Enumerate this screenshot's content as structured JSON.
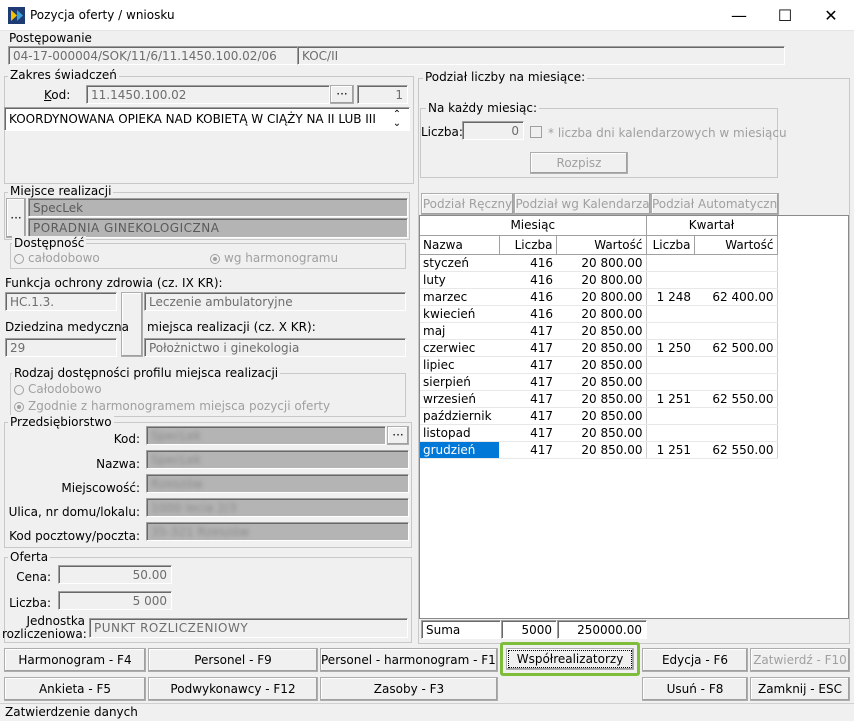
{
  "window": {
    "title": "Pozycja oferty / wniosku",
    "min": "—",
    "max": "☐",
    "close": "✕"
  },
  "postepowanie": {
    "label": "Postępowanie",
    "code": "04-17-000004/SOK/11/6/11.1450.100.02/06",
    "type": "KOC/II"
  },
  "zakres": {
    "label": "Zakres świadczeń",
    "kod_label": "Kod:",
    "kod": "11.1450.100.02",
    "dots": "···",
    "num": "1",
    "desc": "KOORDYNOWANA OPIEKA NAD KOBIETĄ W CIĄŻY NA II LUB III"
  },
  "miejsce": {
    "label": "Miejsce realizacji",
    "dots": "···",
    "name1": "SpecLek",
    "name2": "PORADNIA GINEKOLOGICZNA"
  },
  "dostepnosc": {
    "label": "Dostępność",
    "opt1": "całodobowo",
    "opt2": "wg harmonogramu"
  },
  "funkcja": {
    "label": "Funkcja ochrony zdrowia (cz. IX KR):",
    "code": "HC.1.3.",
    "value": "Leczenie ambulatoryjne"
  },
  "dziedzina": {
    "label": "Dziedzina medyczna",
    "label2": "miejsca realizacji (cz. X KR):",
    "code": "29",
    "value": "Położnictwo i ginekologia"
  },
  "rodzaj": {
    "label": "Rodzaj dostępności profilu miejsca realizacji",
    "opt1": "Całodobowo",
    "opt2": "Zgodnie z harmonogramem miejsca pozycji oferty"
  },
  "przedsiebiorstwo": {
    "label": "Przedsiębiorstwo",
    "kod_label": "Kod:",
    "nazwa_label": "Nazwa:",
    "miejsc_label": "Miejscowość:",
    "ulica_label": "Ulica, nr domu/lokalu:",
    "kodpoczt_label": "Kod pocztowy/poczta:",
    "kod": "SpecLek",
    "nazwa": "SpecLek",
    "miejsc": "Rzeszów",
    "ulica": "1000 lecia 2/3",
    "kodpoczt": "35-321 Rzeszów",
    "dots": "···"
  },
  "oferta": {
    "label": "Oferta",
    "cena_label": "Cena:",
    "cena": "50.00",
    "liczba_label": "Liczba:",
    "liczba": "5 000",
    "jedn_label1": "Jednostka",
    "jedn_label2": "rozliczeniowa:",
    "jedn": "PUNKT ROZLICZENIOWY"
  },
  "podzial": {
    "label": "Podział liczby na miesiące:",
    "kazdy_label": "Na każdy miesiąc:",
    "liczba_label": "Liczba:",
    "liczba": "0",
    "chk_label": "* liczba dni kalendarzowych w miesiącu",
    "rozpisz": "Rozpisz",
    "tab1": "Podział Ręczny",
    "tab2": "Podział wg Kalendarza",
    "tab3": "Podział Automatyczny"
  },
  "grid": {
    "h_miesiac": "Miesiąc",
    "h_kwartal": "Kwartał",
    "h_nazwa": "Nazwa",
    "h_liczba": "Liczba",
    "h_wartosc": "Wartość",
    "h_kliczba": "Liczba",
    "h_kwartosc": "Wartość",
    "rows": [
      {
        "n": "styczeń",
        "l": "416",
        "w": "20 800.00",
        "kl": "",
        "kw": ""
      },
      {
        "n": "luty",
        "l": "416",
        "w": "20 800.00",
        "kl": "",
        "kw": ""
      },
      {
        "n": "marzec",
        "l": "416",
        "w": "20 800.00",
        "kl": "1 248",
        "kw": "62 400.00"
      },
      {
        "n": "kwiecień",
        "l": "416",
        "w": "20 800.00",
        "kl": "",
        "kw": ""
      },
      {
        "n": "maj",
        "l": "417",
        "w": "20 850.00",
        "kl": "",
        "kw": ""
      },
      {
        "n": "czerwiec",
        "l": "417",
        "w": "20 850.00",
        "kl": "1 250",
        "kw": "62 500.00"
      },
      {
        "n": "lipiec",
        "l": "417",
        "w": "20 850.00",
        "kl": "",
        "kw": ""
      },
      {
        "n": "sierpień",
        "l": "417",
        "w": "20 850.00",
        "kl": "",
        "kw": ""
      },
      {
        "n": "wrzesień",
        "l": "417",
        "w": "20 850.00",
        "kl": "1 251",
        "kw": "62 550.00"
      },
      {
        "n": "październik",
        "l": "417",
        "w": "20 850.00",
        "kl": "",
        "kw": ""
      },
      {
        "n": "listopad",
        "l": "417",
        "w": "20 850.00",
        "kl": "",
        "kw": ""
      },
      {
        "n": "grudzień",
        "l": "417",
        "w": "20 850.00",
        "kl": "1 251",
        "kw": "62 550.00"
      }
    ],
    "suma_label": "Suma",
    "suma_l": "5000",
    "suma_w": "250000.00"
  },
  "buttons": {
    "harmonogram": "Harmonogram - F4",
    "personel": "Personel - F9",
    "personel_h": "Personel - harmonogram - F11",
    "wspol": "Współrealizatorzy",
    "edycja": "Edycja - F6",
    "zatwierdz": "Zatwierdź - F10",
    "ankieta": "Ankieta - F5",
    "podwyk": "Podwykonawcy - F12",
    "zasoby": "Zasoby - F3",
    "usun": "Usuń - F8",
    "zamknij": "Zamknij - ESC"
  },
  "status": "Zatwierdzenie danych"
}
